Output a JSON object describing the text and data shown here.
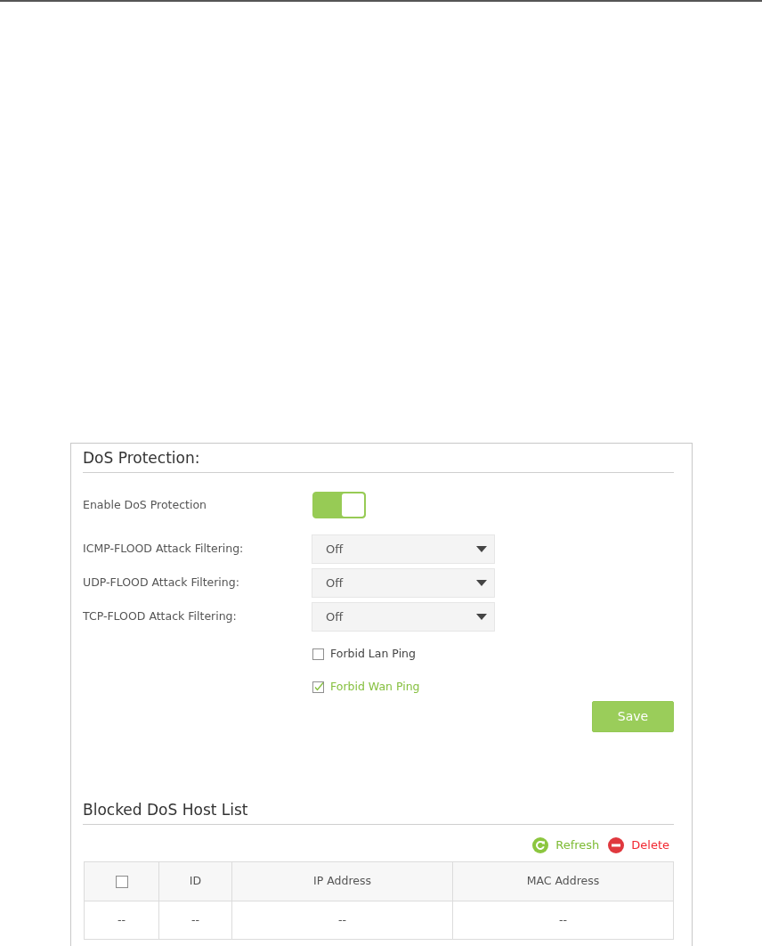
{
  "dos_protection": {
    "title": "DoS Protection:",
    "enable": {
      "label": "Enable DoS Protection",
      "on": true
    },
    "filters": [
      {
        "label": "ICMP-FLOOD Attack Filtering:",
        "value": "Off"
      },
      {
        "label": "UDP-FLOOD Attack Filtering:",
        "value": "Off"
      },
      {
        "label": "TCP-FLOOD Attack Filtering:",
        "value": "Off"
      }
    ],
    "options": [
      {
        "label": "Forbid Lan Ping",
        "checked": false
      },
      {
        "label": "Forbid Wan Ping",
        "checked": true
      }
    ],
    "save_button": "Save"
  },
  "blocked_host_list": {
    "title": "Blocked DoS Host List",
    "actions": [
      {
        "kind": "refresh",
        "label": "Refresh"
      },
      {
        "kind": "delete",
        "label": "Delete"
      }
    ],
    "table": {
      "columns": [
        {
          "kind": "checkbox",
          "checked": false
        },
        {
          "kind": "text",
          "label": "ID"
        },
        {
          "kind": "text",
          "label": "IP Address"
        },
        {
          "kind": "text",
          "label": "MAC Address"
        }
      ],
      "rows": [
        [
          "--",
          "--",
          "--",
          "--"
        ]
      ]
    }
  }
}
